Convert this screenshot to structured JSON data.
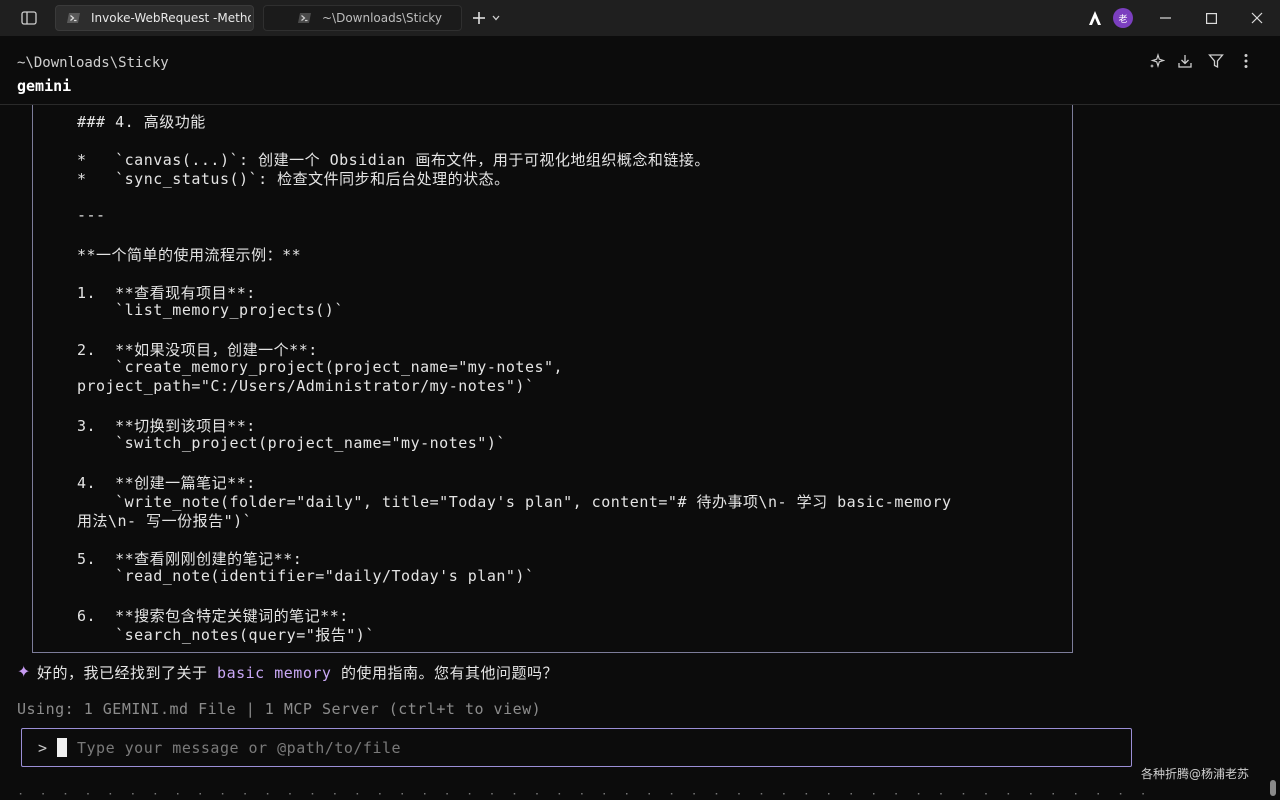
{
  "titlebar": {
    "tabs": [
      {
        "title": "Invoke-WebRequest -Method",
        "active": true
      },
      {
        "title": "~\\Downloads\\Sticky",
        "active": false
      }
    ],
    "avatar_text": "老"
  },
  "header": {
    "path": "~\\Downloads\\Sticky",
    "command": "gemini"
  },
  "content": {
    "lines": [
      "### 4. 高级功能",
      "*   `canvas(...)`: 创建一个 Obsidian 画布文件，用于可视化地组织概念和链接。",
      "*   `sync_status()`: 检查文件同步和后台处理的状态。",
      "---",
      "**一个简单的使用流程示例：**",
      "1.  **查看现有项目**:",
      "    `list_memory_projects()`",
      "2.  **如果没项目，创建一个**:",
      "    `create_memory_project(project_name=\"my-notes\",",
      "project_path=\"C:/Users/Administrator/my-notes\")`",
      "3.  **切换到该项目**:",
      "    `switch_project(project_name=\"my-notes\")`",
      "4.  **创建一篇笔记**:",
      "    `write_note(folder=\"daily\", title=\"Today's plan\", content=\"# 待办事项\\n- 学习 basic-memory",
      "用法\\n- 写一份报告\")`",
      "5.  **查看刚刚创建的笔记**:",
      "    `read_note(identifier=\"daily/Today's plan\")`",
      "6.  **搜索包含特定关键词的笔记**:",
      "    `search_notes(query=\"报告\")`"
    ]
  },
  "reply": {
    "star": "✦",
    "before": "好的，我已经找到了关于 ",
    "highlight": "basic memory",
    "after": " 的使用指南。您有其他问题吗？"
  },
  "status": {
    "text": "Using: 1 GEMINI.md File | 1 MCP Server (ctrl+t to view)"
  },
  "input": {
    "prompt": ">",
    "placeholder": "Type your message or @path/to/file"
  },
  "watermark": "各种折腾@杨浦老苏",
  "colors": {
    "accent": "#c9a8f5",
    "input_border": "#9b8fd6",
    "avatar_bg": "#7b3fbf"
  }
}
